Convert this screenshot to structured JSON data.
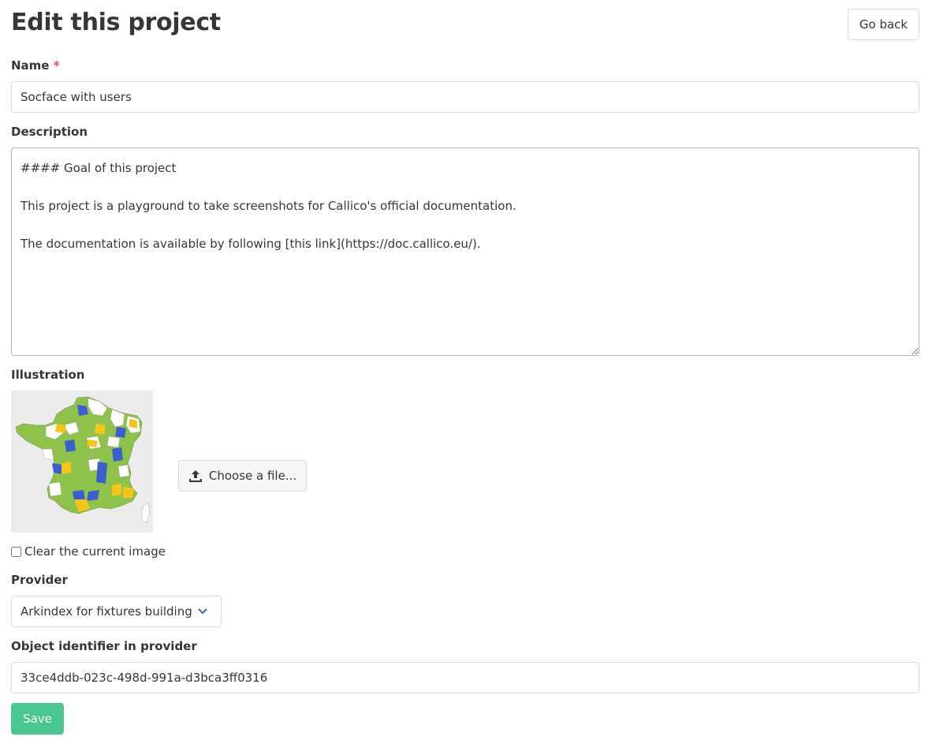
{
  "page": {
    "title": "Edit this project",
    "back_label": "Go back"
  },
  "form": {
    "name_label": "Name",
    "name_required_mark": "*",
    "name_value": "Socface with users",
    "description_label": "Description",
    "description_value": "#### Goal of this project\n\nThis project is a playground to take screenshots for Callico's official documentation.\n\nThe documentation is available by following [this link](https://doc.callico.eu/).",
    "illustration_label": "Illustration",
    "illustration_icon": "france-map-image",
    "choose_file_label": "Choose a file...",
    "upload_icon": "upload-icon",
    "clear_image_label": "Clear the current image",
    "provider_label": "Provider",
    "provider_selected": "Arkindex for fixtures building",
    "object_id_label": "Object identifier in provider",
    "object_id_value": "33ce4ddb-023c-498d-991a-d3bca3ff0316",
    "save_label": "Save"
  },
  "colors": {
    "primary_success": "#48c78e",
    "required_mark": "#f14668",
    "map_green": "#8fc24a",
    "map_blue": "#3b5fd0",
    "map_yellow": "#f5c518",
    "chevron": "#3e5cc7"
  }
}
